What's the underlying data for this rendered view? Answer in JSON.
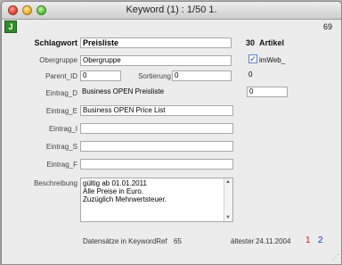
{
  "window": {
    "title": "Keyword (1) : 1/50 1."
  },
  "app_icon_text": "J",
  "record_number": "69",
  "form": {
    "schlagwort_label": "Schlagwort",
    "schlagwort_value": "Preisliste",
    "artikel_count": "30",
    "artikel_label": "Artikel",
    "obergruppe_label": "Obergruppe",
    "obergruppe_value": "Obergruppe",
    "imweb_label": "imWeb_",
    "imweb_checked": true,
    "parent_label": "Parent_ID",
    "parent_value": "0",
    "sortierung_label": "Sortierung",
    "sortierung_value": "0",
    "sortierung_extra": "0",
    "eintrag_d_label": "Eintrag_D",
    "eintrag_d_value": "Business OPEN Preisliste",
    "eintrag_d_extra": "0",
    "eintrag_e_label": "Eintrag_E",
    "eintrag_e_value": "Business OPEN Price List",
    "eintrag_i_label": "Eintrag_I",
    "eintrag_i_value": "",
    "eintrag_s_label": "Eintrag_S",
    "eintrag_s_value": "",
    "eintrag_f_label": "Eintrag_F",
    "eintrag_f_value": "",
    "beschreibung_label": "Beschreibung",
    "beschreibung_lines": [
      "gültig ab 01.01.2011",
      "Alle Preise in Euro.",
      "Zuzüglich Mehrwertsteuer."
    ]
  },
  "footer": {
    "datasets_label": "Datensätze in KeywordRef",
    "datasets_value": "65",
    "aeltester_label": "ältester",
    "aeltester_value": "24.11.2004",
    "page1": "1",
    "page2": "2",
    "page1_color": "#d01818",
    "page2_color": "#1830c8"
  }
}
